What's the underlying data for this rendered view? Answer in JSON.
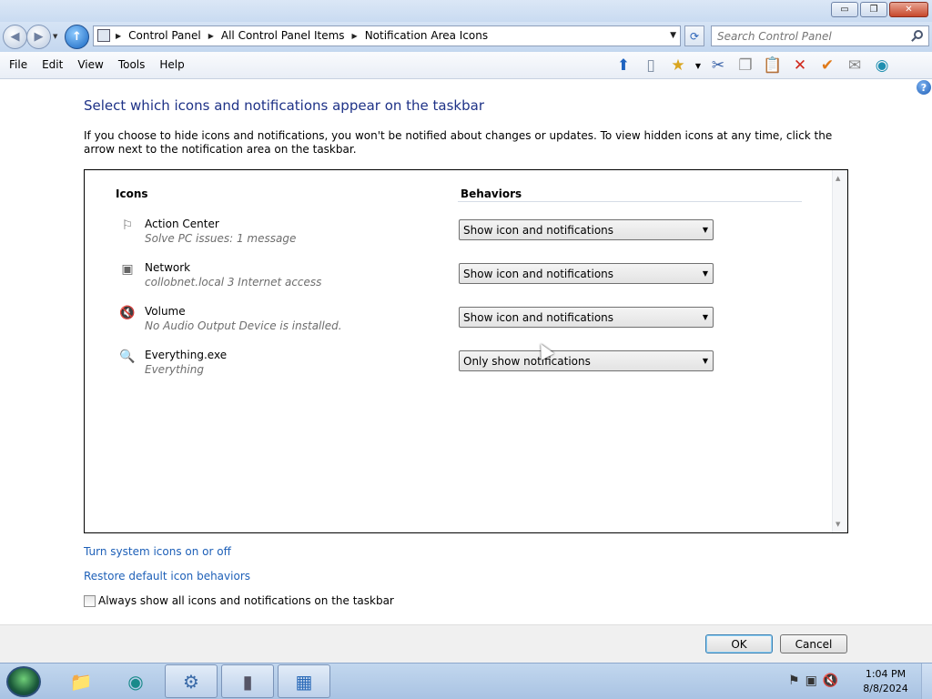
{
  "window": {
    "minimize": "▭",
    "maximize": "❐",
    "close": "✕"
  },
  "nav": {
    "breadcrumbs": [
      "Control Panel",
      "All Control Panel Items",
      "Notification Area Icons"
    ],
    "search_placeholder": "Search Control Panel"
  },
  "menu": [
    "File",
    "Edit",
    "View",
    "Tools",
    "Help"
  ],
  "toolbar_icons": [
    "up-arrow-icon",
    "panel-icon",
    "favorites-icon",
    "dropdown-icon",
    "cut-icon",
    "copy-icon",
    "paste-icon",
    "delete-icon",
    "checkmark-icon",
    "mail-icon",
    "globe-icon"
  ],
  "content": {
    "heading": "Select which icons and notifications appear on the taskbar",
    "description": "If you choose to hide icons and notifications, you won't be notified about changes or updates. To view hidden icons at any time, click the arrow next to the notification area on the taskbar.",
    "columns": {
      "icons": "Icons",
      "behaviors": "Behaviors"
    },
    "rows": [
      {
        "name": "Action Center",
        "sub": "Solve PC issues: 1 message",
        "behavior": "Show icon and notifications",
        "icon": "flag-icon"
      },
      {
        "name": "Network",
        "sub": "collobnet.local  3 Internet access",
        "behavior": "Show icon and notifications",
        "icon": "network-icon"
      },
      {
        "name": "Volume",
        "sub": "No Audio Output Device is installed.",
        "behavior": "Show icon and notifications",
        "icon": "volume-muted-icon"
      },
      {
        "name": "Everything.exe",
        "sub": "Everything",
        "behavior": "Only show notifications",
        "icon": "search-magnifier-icon"
      }
    ],
    "links": [
      "Turn system icons on or off",
      "Restore default icon behaviors"
    ],
    "checkbox_label": "Always show all icons and notifications on the taskbar",
    "checkbox_checked": false
  },
  "footer": {
    "ok": "OK",
    "cancel": "Cancel"
  },
  "taskbar": {
    "time": "1:04 PM",
    "date": "8/8/2024"
  }
}
